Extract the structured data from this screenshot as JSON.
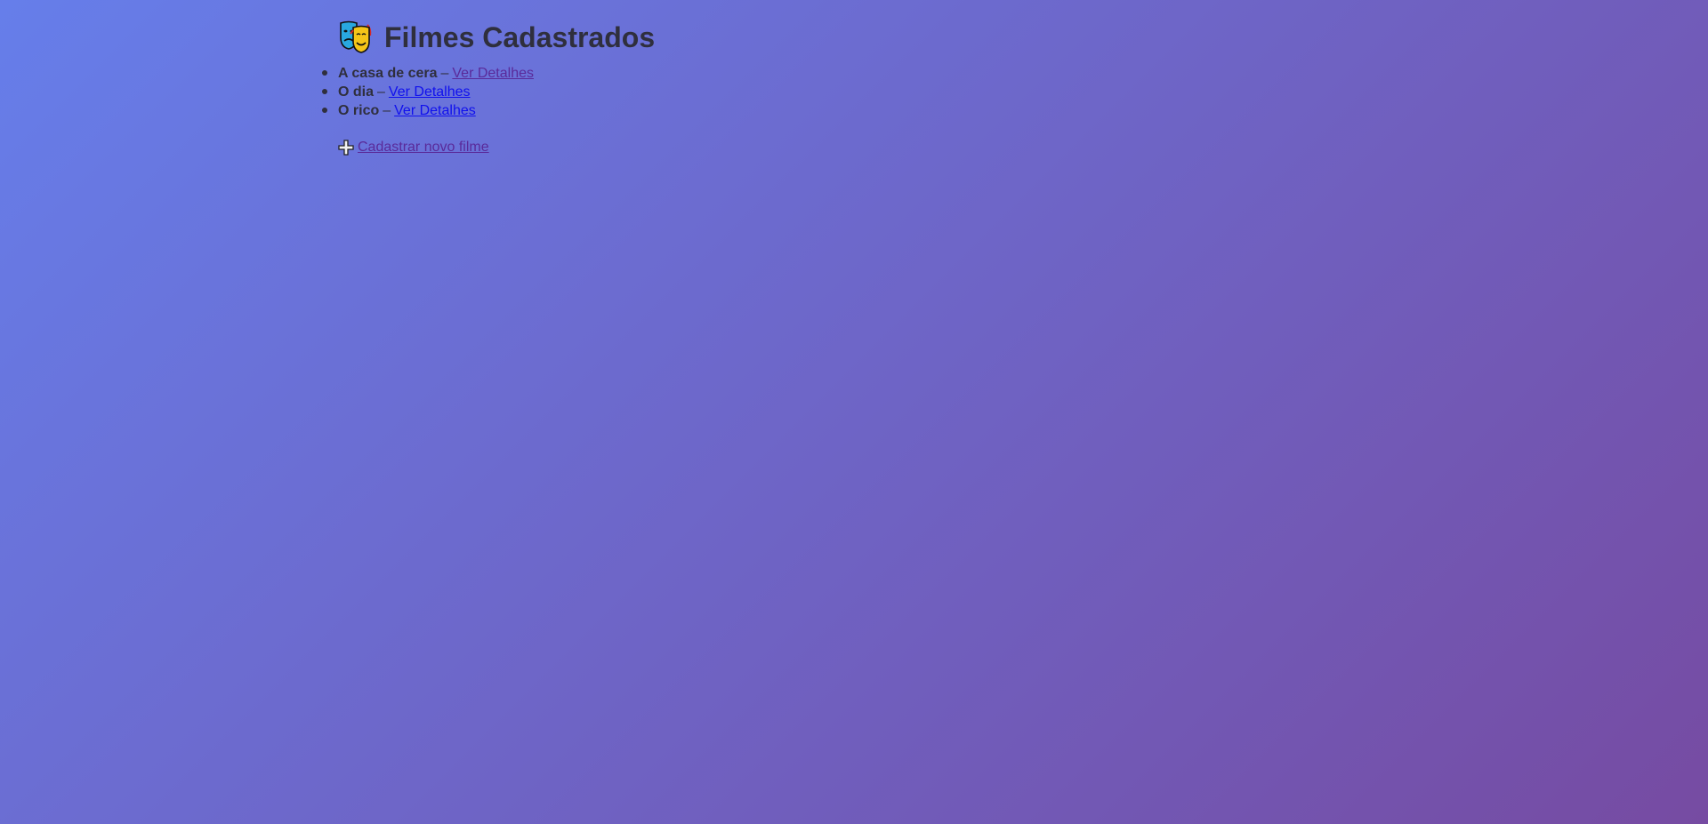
{
  "header": {
    "title": "Filmes Cadastrados",
    "icon": "performing-arts-masks-icon"
  },
  "movies": [
    {
      "title": "A casa de cera",
      "separator": "–",
      "link_label": "Ver Detalhes",
      "visited": true
    },
    {
      "title": "O dia",
      "separator": "–",
      "link_label": "Ver Detalhes",
      "visited": false
    },
    {
      "title": "O rico",
      "separator": "–",
      "link_label": "Ver Detalhes",
      "visited": false
    }
  ],
  "add_movie": {
    "icon": "plus-icon",
    "label": "Cadastrar novo filme"
  },
  "colors": {
    "background_start": "#667eea",
    "background_end": "#764ba2",
    "text": "#2f2f3d",
    "link_visited": "#5a2a9a",
    "link_unvisited": "#1010ee"
  }
}
